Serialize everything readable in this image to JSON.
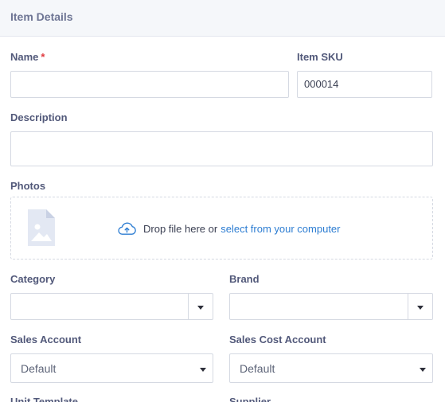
{
  "header": {
    "title": "Item Details"
  },
  "name": {
    "label": "Name",
    "required_mark": "*",
    "value": ""
  },
  "sku": {
    "label": "Item SKU",
    "value": "000014"
  },
  "description": {
    "label": "Description",
    "value": ""
  },
  "photos": {
    "label": "Photos",
    "drop_text": "Drop file here or",
    "link_text": "select from your computer",
    "icons": [
      "file-image-icon",
      "cloud-upload-icon"
    ],
    "link_color": "#2d7dd2"
  },
  "category": {
    "label": "Category",
    "value": ""
  },
  "brand": {
    "label": "Brand",
    "value": ""
  },
  "sales_account": {
    "label": "Sales Account",
    "value": "Default"
  },
  "sales_cost_account": {
    "label": "Sales Cost Account",
    "value": "Default"
  },
  "unit_template": {
    "label": "Unit Template"
  },
  "supplier": {
    "label": "Supplier"
  }
}
